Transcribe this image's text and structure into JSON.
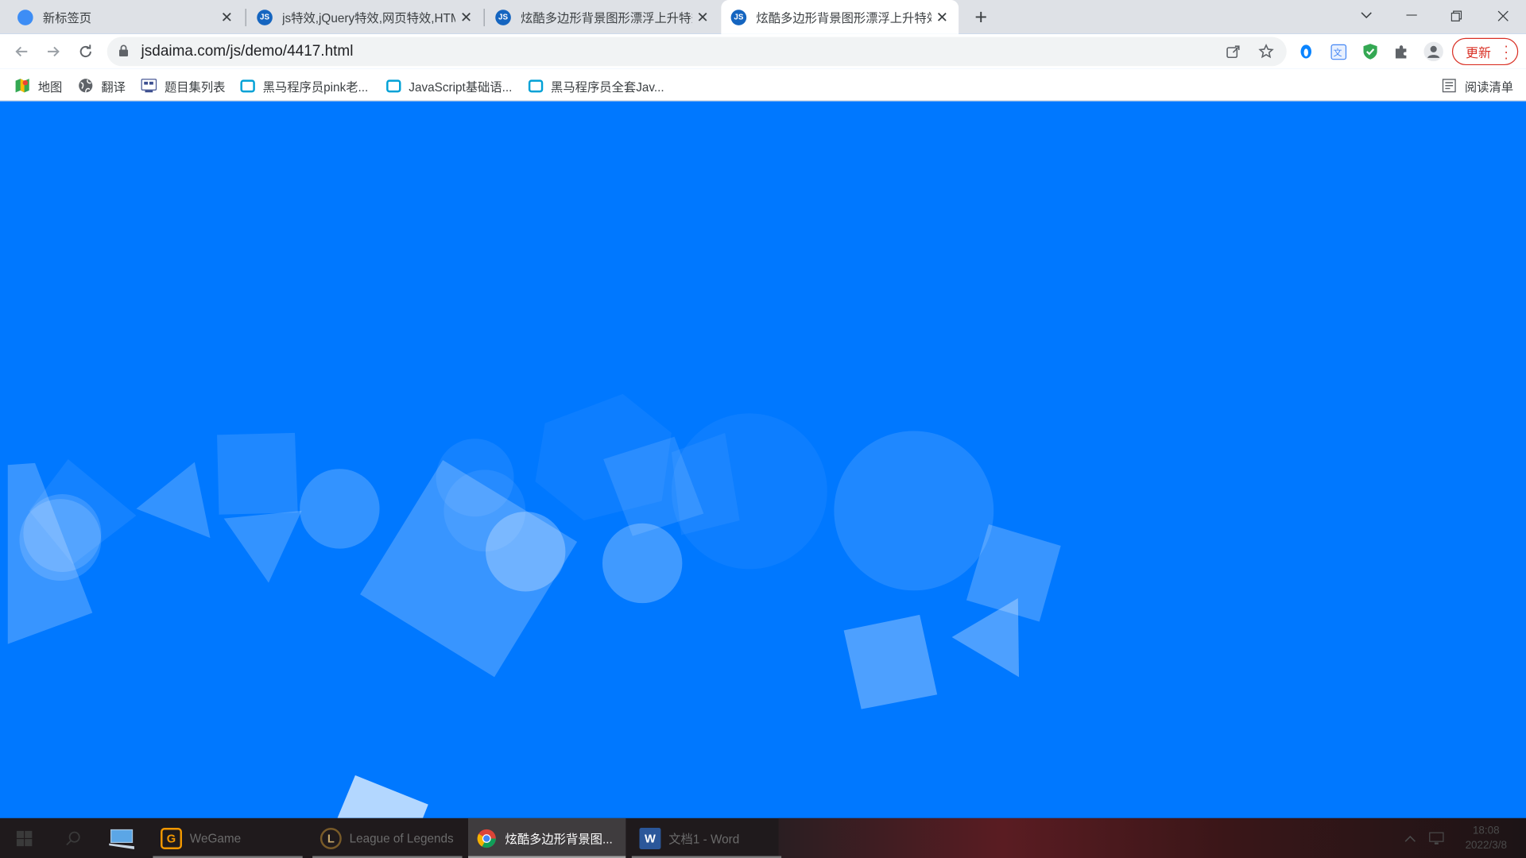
{
  "browser": {
    "tabs": [
      {
        "title": "新标签页",
        "favicon": "new-tab-icon",
        "active": false
      },
      {
        "title": "js特效,jQuery特效,网页特效,HTML",
        "favicon": "js-icon",
        "active": false
      },
      {
        "title": "炫酷多边形背景图形漂浮上升特效",
        "favicon": "js-icon",
        "active": false
      },
      {
        "title": "炫酷多边形背景图形漂浮上升特效",
        "favicon": "js-icon",
        "active": true
      }
    ],
    "favicon_text": "JS",
    "new_tab_icon": "plus-icon",
    "window_controls": [
      "chevron-down-icon",
      "minimize-icon",
      "restore-icon",
      "close-icon"
    ]
  },
  "toolbar": {
    "url": "jsdaima.com/js/demo/4417.html",
    "update_label": "更新",
    "extensions": [
      "share-icon",
      "star-icon",
      "qq-browser-icon",
      "translate-icon",
      "shield-icon",
      "puzzle-icon",
      "profile-icon"
    ]
  },
  "bookmarks": {
    "items": [
      {
        "label": "地图",
        "icon": "maps-icon"
      },
      {
        "label": "翻译",
        "icon": "globe-icon"
      },
      {
        "label": "题目集列表",
        "icon": "list-icon"
      },
      {
        "label": "黑马程序员pink老...",
        "icon": "bilibili-icon"
      },
      {
        "label": "JavaScript基础语...",
        "icon": "bilibili-icon"
      },
      {
        "label": "黑马程序员全套Jav...",
        "icon": "bilibili-icon"
      }
    ],
    "reading_list": "阅读清单"
  },
  "page": {
    "background": "#0078ff",
    "shape_color": "#ffffff"
  },
  "taskbar": {
    "apps": [
      {
        "label": "WeGame",
        "icon": "wegame-icon",
        "active": false
      },
      {
        "label": "League of Legends",
        "icon": "lol-icon",
        "active": false
      },
      {
        "label": "炫酷多边形背景图...",
        "icon": "chrome-icon",
        "active": true
      },
      {
        "label": "文档1 - Word",
        "icon": "word-icon",
        "active": false
      }
    ],
    "clock": {
      "time": "18:08",
      "date": "2022/3/8"
    }
  }
}
